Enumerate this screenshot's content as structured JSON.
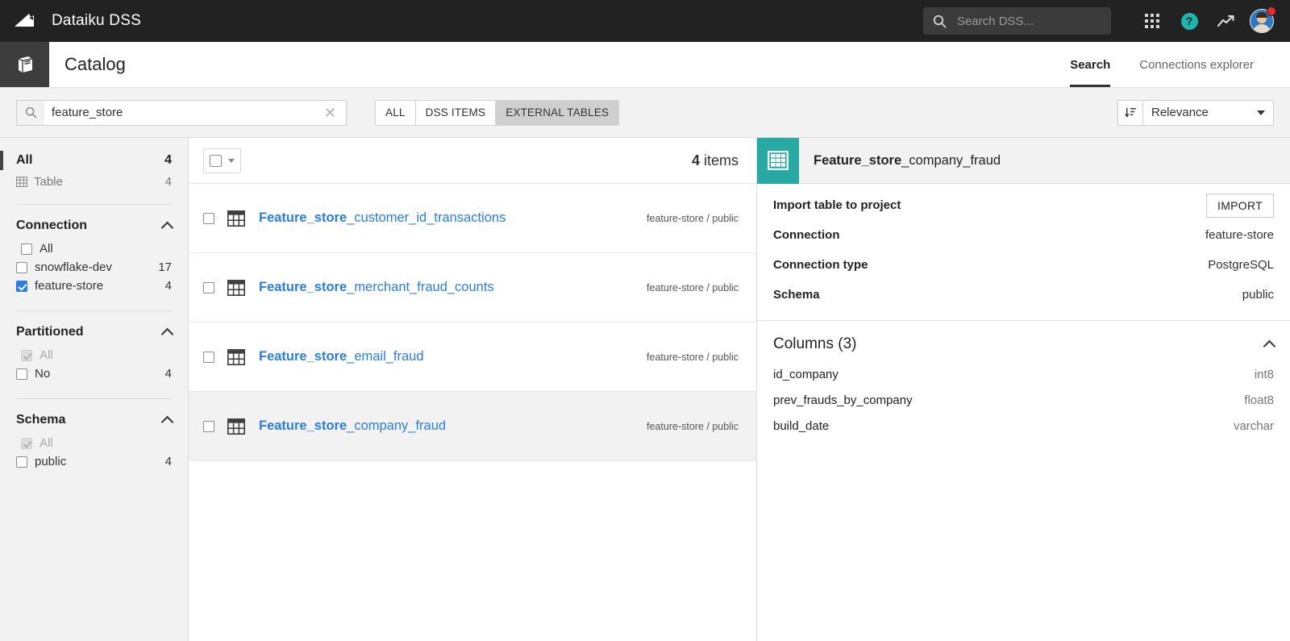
{
  "topbar": {
    "app_title": "Dataiku DSS",
    "logo_icon": "dataiku-logo-icon",
    "search": {
      "value": "",
      "placeholder": "Search DSS..."
    },
    "apps_icon": "apps-grid-icon",
    "help_icon": "help-circle-icon",
    "help_glyph": "?",
    "trend_icon": "trending-up-icon",
    "avatar_icon": "user-avatar",
    "notification_badge": ""
  },
  "header": {
    "icon": "catalog-book-icon",
    "title": "Catalog",
    "tabs": [
      {
        "label": "Search",
        "active": true
      },
      {
        "label": "Connections explorer",
        "active": false
      }
    ]
  },
  "toolbar": {
    "search": {
      "value": "feature_store",
      "placeholder": "Search"
    },
    "search_icon": "search-icon",
    "clear_icon": "clear-x-icon",
    "segments": [
      {
        "label": "ALL",
        "active": false
      },
      {
        "label": "DSS ITEMS",
        "active": false
      },
      {
        "label": "EXTERNAL TABLES",
        "active": true
      }
    ],
    "sort_icon": "sort-descending-icon",
    "sort_value": "Relevance"
  },
  "facets": {
    "all": {
      "label": "All",
      "count": "4"
    },
    "type": {
      "label": "Table",
      "count": "4",
      "icon": "table-icon"
    },
    "groups": [
      {
        "title": "Connection",
        "collapse_icon": "chevron-up-icon",
        "options": [
          {
            "label": "All",
            "count": "",
            "checked": false,
            "disabled": false
          },
          {
            "label": "snowflake-dev",
            "count": "17",
            "checked": false,
            "disabled": false
          },
          {
            "label": "feature-store",
            "count": "4",
            "checked": true,
            "disabled": false
          }
        ]
      },
      {
        "title": "Partitioned",
        "collapse_icon": "chevron-up-icon",
        "options": [
          {
            "label": "All",
            "count": "",
            "checked": true,
            "disabled": true
          },
          {
            "label": "No",
            "count": "4",
            "checked": false,
            "disabled": false
          }
        ]
      },
      {
        "title": "Schema",
        "collapse_icon": "chevron-up-icon",
        "options": [
          {
            "label": "All",
            "count": "",
            "checked": true,
            "disabled": true
          },
          {
            "label": "public",
            "count": "4",
            "checked": false,
            "disabled": false
          }
        ]
      }
    ]
  },
  "results": {
    "select_all_icon": "select-all-checkbox",
    "dropdown_icon": "chevron-down-icon",
    "count_number": "4",
    "count_label": " items",
    "rows": [
      {
        "icon": "table-icon",
        "name_match": "Feature_store",
        "name_rest": "_customer_id_transactions",
        "location": "feature-store / public",
        "selected": false
      },
      {
        "icon": "table-icon",
        "name_match": "Feature_store",
        "name_rest": "_merchant_fraud_counts",
        "location": "feature-store / public",
        "selected": false
      },
      {
        "icon": "table-icon",
        "name_match": "Feature_store",
        "name_rest": "_email_fraud",
        "location": "feature-store / public",
        "selected": false
      },
      {
        "icon": "table-icon",
        "name_match": "Feature_store",
        "name_rest": "_company_fraud",
        "location": "feature-store / public",
        "selected": true
      }
    ]
  },
  "detail": {
    "badge_icon": "table-icon",
    "title_match": "Feature_store",
    "title_rest": "_company_fraud",
    "import_row_label": "Import table to project",
    "import_button": "IMPORT",
    "fields": [
      {
        "label": "Connection",
        "value": "feature-store"
      },
      {
        "label": "Connection type",
        "value": "PostgreSQL"
      },
      {
        "label": "Schema",
        "value": "public"
      }
    ],
    "columns_title": "Columns (3)",
    "columns_collapse_icon": "chevron-up-icon",
    "columns": [
      {
        "name": "id_company",
        "type": "int8"
      },
      {
        "name": "prev_frauds_by_company",
        "type": "float8"
      },
      {
        "name": "build_date",
        "type": "varchar"
      }
    ]
  },
  "colors": {
    "accent_blue": "#2a7de1",
    "teal": "#29a9a3",
    "topbar_bg": "#222222",
    "panel_bg": "#f2f2f2",
    "help_teal": "#22b3ad",
    "notify_red": "#e52a2a"
  }
}
